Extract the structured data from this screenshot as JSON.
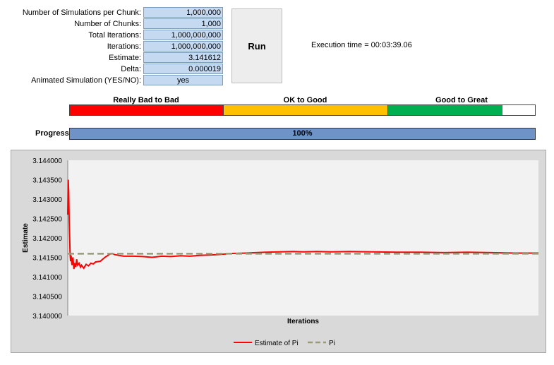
{
  "params": {
    "sims_per_chunk": {
      "label": "Number of Simulations per Chunk:",
      "value": "1,000,000"
    },
    "num_chunks": {
      "label": "Number of Chunks:",
      "value": "1,000"
    },
    "total_iterations": {
      "label": "Total Iterations:",
      "value": "1,000,000,000"
    },
    "iterations": {
      "label": "Iterations:",
      "value": "1,000,000,000"
    },
    "estimate": {
      "label": "Estimate:",
      "value": "3.141612"
    },
    "delta": {
      "label": "Delta:",
      "value": "0.000019"
    },
    "animated": {
      "label": "Animated Simulation (YES/NO):",
      "value": "yes"
    }
  },
  "run_button": {
    "label": "Run"
  },
  "execution_time": "Execution time = 00:03:39.06",
  "quality_scale": {
    "headers": [
      "Really Bad to Bad",
      "OK to Good",
      "Good to Great"
    ],
    "colors": [
      "#ff0000",
      "#ffc000",
      "#00b050"
    ],
    "fill_fraction": 0.93
  },
  "progress": {
    "label": "Progress:",
    "value_text": "100%",
    "fraction": 1.0,
    "color": "#6f93c6"
  },
  "chart_data": {
    "type": "line",
    "xlabel": "Iterations",
    "ylabel": "Estimate",
    "ylim": [
      3.14,
      3.144
    ],
    "yticks": [
      "3.140000",
      "3.140500",
      "3.141000",
      "3.141500",
      "3.142000",
      "3.142500",
      "3.143000",
      "3.143500",
      "3.144000"
    ],
    "grid": false,
    "legend_position": "bottom",
    "x_count": 1000,
    "series": [
      {
        "name": "Estimate of Pi",
        "color": "#ff0000",
        "style": "solid",
        "points": [
          [
            1,
            3.1426
          ],
          [
            2,
            3.1435
          ],
          [
            3,
            3.1432
          ],
          [
            4,
            3.1425
          ],
          [
            5,
            3.142
          ],
          [
            6,
            3.1416
          ],
          [
            7,
            3.1414
          ],
          [
            8,
            3.14155
          ],
          [
            10,
            3.1413
          ],
          [
            12,
            3.1415
          ],
          [
            14,
            3.1412
          ],
          [
            16,
            3.14135
          ],
          [
            18,
            3.14125
          ],
          [
            20,
            3.14145
          ],
          [
            22,
            3.1413
          ],
          [
            25,
            3.14135
          ],
          [
            28,
            3.14125
          ],
          [
            30,
            3.1413
          ],
          [
            35,
            3.14122
          ],
          [
            40,
            3.14132
          ],
          [
            45,
            3.14128
          ],
          [
            50,
            3.14135
          ],
          [
            55,
            3.14133
          ],
          [
            60,
            3.14138
          ],
          [
            70,
            3.1414
          ],
          [
            80,
            3.1415
          ],
          [
            90,
            3.14158
          ],
          [
            95,
            3.1416
          ],
          [
            100,
            3.14157
          ],
          [
            110,
            3.14155
          ],
          [
            120,
            3.14153
          ],
          [
            140,
            3.14153
          ],
          [
            160,
            3.14152
          ],
          [
            180,
            3.1415
          ],
          [
            200,
            3.14153
          ],
          [
            220,
            3.14152
          ],
          [
            240,
            3.14154
          ],
          [
            260,
            3.14153
          ],
          [
            280,
            3.14155
          ],
          [
            300,
            3.14156
          ],
          [
            320,
            3.14157
          ],
          [
            350,
            3.1416
          ],
          [
            380,
            3.14161
          ],
          [
            400,
            3.14162
          ],
          [
            420,
            3.14163
          ],
          [
            450,
            3.14164
          ],
          [
            480,
            3.14165
          ],
          [
            500,
            3.14164
          ],
          [
            530,
            3.14165
          ],
          [
            560,
            3.14164
          ],
          [
            600,
            3.14165
          ],
          [
            650,
            3.14164
          ],
          [
            700,
            3.14163
          ],
          [
            750,
            3.14163
          ],
          [
            800,
            3.14162
          ],
          [
            850,
            3.14163
          ],
          [
            900,
            3.14162
          ],
          [
            950,
            3.14161
          ],
          [
            1000,
            3.14161
          ]
        ]
      },
      {
        "name": "Pi",
        "color": "#999a7a",
        "style": "dashed",
        "points": [
          [
            1,
            3.141593
          ],
          [
            1000,
            3.141593
          ]
        ]
      }
    ]
  }
}
